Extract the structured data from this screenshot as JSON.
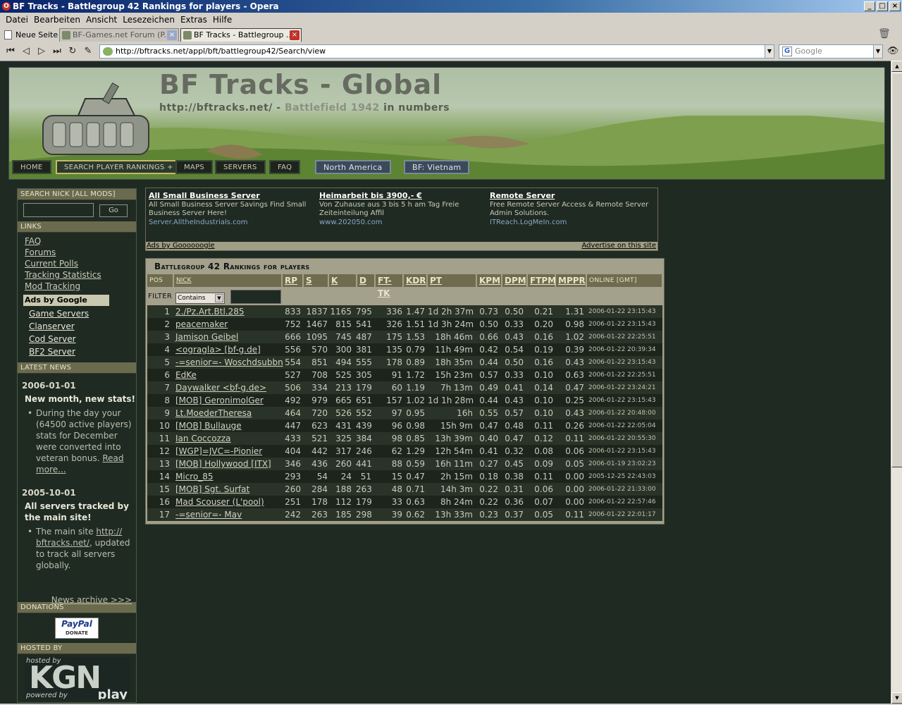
{
  "window": {
    "title": "BF Tracks - Battlegroup 42 Rankings for players - Opera"
  },
  "menu": [
    "Datei",
    "Bearbeiten",
    "Ansicht",
    "Lesezeichen",
    "Extras",
    "Hilfe"
  ],
  "tabs": {
    "new_page": "Neue Seite",
    "items": [
      {
        "label": "BF-Games.net Forum (P..."
      },
      {
        "label": "BF Tracks - Battlegroup ..."
      }
    ]
  },
  "address": {
    "url": "http://bftracks.net/appl/bft/battlegroup42/Search/view",
    "search_placeholder": "Google"
  },
  "banner": {
    "title": "BF Tracks - Global",
    "sub_url": "http://bftracks.net/",
    "sub_dash": " - ",
    "sub_game": "Battlefield 1942",
    "sub_tail": " in numbers"
  },
  "nav": [
    {
      "label": "HOME"
    },
    {
      "label": "SEARCH PLAYER RANKINGS +"
    },
    {
      "label": "MAPS"
    },
    {
      "label": "SERVERS"
    },
    {
      "label": "FAQ"
    },
    {
      "label": "North America"
    },
    {
      "label": "BF: Vietnam"
    }
  ],
  "sidebar": {
    "search_head": "SEARCH NICK [ALL MODS]",
    "go": "Go",
    "links_head": "LINKS",
    "links": [
      "FAQ",
      "Forums",
      "Current Polls",
      "Tracking Statistics",
      "Mod Tracking"
    ],
    "ads_label": "Ads by Google",
    "ad_links": [
      "Game Servers",
      "Clanserver",
      "Cod Server",
      "BF2 Server"
    ],
    "news_head": "LATEST NEWS",
    "news": [
      {
        "date": "2006-01-01",
        "headline": "New month, new stats!",
        "text": "During the day your (64500 active players) stats for December were converted into veteran bonus.",
        "link": "Read more..."
      },
      {
        "date": "2005-10-01",
        "headline": "All servers tracked by the main site!",
        "text_pre": "The main site ",
        "link": "http:// bftracks.net/",
        "text_post": ", updated to track all servers globally."
      }
    ],
    "news_archive": "News archive >>>",
    "donations_head": "DONATIONS",
    "paypal": "PayPal",
    "paypal_sub": "DONATE",
    "hosted_head": "HOSTED BY",
    "hosted_by": "hosted by",
    "kgn": "KGN",
    "powered_by": "powered by",
    "play": "play"
  },
  "ads": {
    "items": [
      {
        "title": "All Small Business Server",
        "text": "All Small Business Server Savings Find Small Business Server Here!",
        "url": "Server.AlltheIndustrials.com"
      },
      {
        "title": "Heimarbeit bis 3900,- €",
        "text": "Von Zuhause aus 3 bis 5 h am Tag Freie Zeiteinteilung Affil",
        "url": "www.202050.com"
      },
      {
        "title": "Remote Server",
        "text": "Free Remote Server Access & Remote Server Admin Solutions.",
        "url": "ITReach.LogMeIn.com"
      }
    ],
    "by": "Ads by Goooooogle",
    "advertise": "Advertise on this site"
  },
  "rankings": {
    "title": "Battlegroup 42 Rankings for players",
    "headers": [
      "POS",
      "NICK",
      "RP",
      "S",
      "K",
      "D",
      "FT-TK",
      "KDR",
      "PT",
      "KPM",
      "DPM",
      "FTPM",
      "MPPR",
      "ONLINE [GMT]"
    ],
    "filter_label": "FILTER",
    "filter_value": "Contains",
    "rows": [
      [
        "1",
        "2./Pz.Art.Btl.285",
        "833",
        "1837",
        "1165",
        "795",
        "336",
        "1.47",
        "1d 2h 37m",
        "0.73",
        "0.50",
        "0.21",
        "1.31",
        "2006-01-22 23:15:43"
      ],
      [
        "2",
        "peacemaker",
        "752",
        "1467",
        "815",
        "541",
        "326",
        "1.51",
        "1d 3h 24m",
        "0.50",
        "0.33",
        "0.20",
        "0.98",
        "2006-01-22 23:15:43"
      ],
      [
        "3",
        "Jamison Geibel",
        "666",
        "1095",
        "745",
        "487",
        "175",
        "1.53",
        "18h 46m",
        "0.66",
        "0.43",
        "0.16",
        "1.02",
        "2006-01-22 22:25:51"
      ],
      [
        "4",
        "<ogragla> [bf-g.de]",
        "556",
        "570",
        "300",
        "381",
        "135",
        "0.79",
        "11h 49m",
        "0.42",
        "0.54",
        "0.19",
        "0.39",
        "2006-01-22 20:39:34"
      ],
      [
        "5",
        "-=senior=- Woschdsubbn",
        "554",
        "851",
        "494",
        "555",
        "178",
        "0.89",
        "18h 35m",
        "0.44",
        "0.50",
        "0.16",
        "0.43",
        "2006-01-22 23:15:43"
      ],
      [
        "6",
        "EdKe",
        "527",
        "708",
        "525",
        "305",
        "91",
        "1.72",
        "15h 23m",
        "0.57",
        "0.33",
        "0.10",
        "0.63",
        "2006-01-22 22:25:51"
      ],
      [
        "7",
        "Daywalker <bf-g.de>",
        "506",
        "334",
        "213",
        "179",
        "60",
        "1.19",
        "7h 13m",
        "0.49",
        "0.41",
        "0.14",
        "0.47",
        "2006-01-22 23:24:21"
      ],
      [
        "8",
        "[MOB] GeronimolGer",
        "492",
        "979",
        "665",
        "651",
        "157",
        "1.02",
        "1d 1h 28m",
        "0.44",
        "0.43",
        "0.10",
        "0.25",
        "2006-01-22 23:15:43"
      ],
      [
        "9",
        "Lt.MoederTheresa",
        "464",
        "720",
        "526",
        "552",
        "97",
        "0.95",
        "16h",
        "0.55",
        "0.57",
        "0.10",
        "0.43",
        "2006-01-22 20:48:00"
      ],
      [
        "10",
        "[MOB] Bullauge",
        "447",
        "623",
        "431",
        "439",
        "96",
        "0.98",
        "15h 9m",
        "0.47",
        "0.48",
        "0.11",
        "0.26",
        "2006-01-22 22:05:04"
      ],
      [
        "11",
        "Ian Coccozza",
        "433",
        "521",
        "325",
        "384",
        "98",
        "0.85",
        "13h 39m",
        "0.40",
        "0.47",
        "0.12",
        "0.11",
        "2006-01-22 20:55:30"
      ],
      [
        "12",
        "[WGP]=JVC=-Pionier",
        "404",
        "442",
        "317",
        "246",
        "62",
        "1.29",
        "12h 54m",
        "0.41",
        "0.32",
        "0.08",
        "0.06",
        "2006-01-22 23:15:43"
      ],
      [
        "13",
        "[MOB] Hollywood [ITX]",
        "346",
        "436",
        "260",
        "441",
        "88",
        "0.59",
        "16h 11m",
        "0.27",
        "0.45",
        "0.09",
        "0.05",
        "2006-01-19 23:02:23"
      ],
      [
        "14",
        "Micro_85",
        "293",
        "54",
        "24",
        "51",
        "15",
        "0.47",
        "2h 15m",
        "0.18",
        "0.38",
        "0.11",
        "0.00",
        "2005-12-25 22:43:03"
      ],
      [
        "15",
        "[MOB] Sgt. Surfat",
        "260",
        "284",
        "188",
        "263",
        "48",
        "0.71",
        "14h 3m",
        "0.22",
        "0.31",
        "0.06",
        "0.00",
        "2006-01-22 21:33:00"
      ],
      [
        "16",
        "Mad Scouser (L'pool)",
        "251",
        "178",
        "112",
        "179",
        "33",
        "0.63",
        "8h 24m",
        "0.22",
        "0.36",
        "0.07",
        "0.00",
        "2006-01-22 22:57:46"
      ],
      [
        "17",
        "-=senior=- Mav",
        "242",
        "263",
        "185",
        "298",
        "39",
        "0.62",
        "13h 33m",
        "0.23",
        "0.37",
        "0.05",
        "0.11",
        "2006-01-22 22:01:17"
      ]
    ]
  },
  "colors": {
    "page_bg": "#1f2a22",
    "panel": "#a3a08c",
    "header": "#6e6c4e",
    "accent_blue": "#3a4a5a"
  }
}
